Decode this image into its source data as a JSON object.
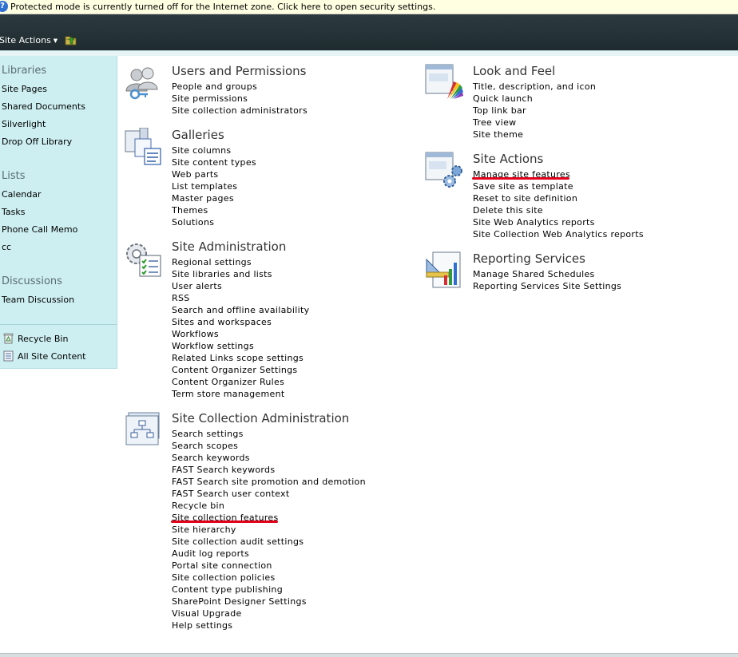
{
  "infobar": {
    "text": "Protected mode is currently turned off for the Internet zone.  Click here to open security settings.",
    "icon": "shield-info-icon"
  },
  "topbar": {
    "site_actions_label": "Site Actions",
    "nav_icon": "navigate-up-icon"
  },
  "quicklaunch": {
    "libraries_heading": "Libraries",
    "libraries": [
      "Site Pages",
      "Shared Documents",
      "Silverlight",
      "Drop Off Library"
    ],
    "lists_heading": "Lists",
    "lists": [
      "Calendar",
      "Tasks",
      "Phone Call Memo",
      "cc"
    ],
    "discussions_heading": "Discussions",
    "discussions": [
      "Team Discussion"
    ],
    "recycle_bin": "Recycle Bin",
    "all_site_content": "All Site Content"
  },
  "sections": {
    "users": {
      "title": "Users and Permissions",
      "links": [
        "People and groups",
        "Site permissions",
        "Site collection administrators"
      ]
    },
    "galleries": {
      "title": "Galleries",
      "links": [
        "Site columns",
        "Site content types",
        "Web parts",
        "List templates",
        "Master pages",
        "Themes",
        "Solutions"
      ]
    },
    "site_admin": {
      "title": "Site Administration",
      "links": [
        "Regional settings",
        "Site libraries and lists",
        "User alerts",
        "RSS",
        "Search and offline availability",
        "Sites and workspaces",
        "Workflows",
        "Workflow settings",
        "Related Links scope settings",
        "Content Organizer Settings",
        "Content Organizer Rules",
        "Term store management"
      ]
    },
    "site_collection_admin": {
      "title": "Site Collection Administration",
      "links": [
        "Search settings",
        "Search scopes",
        "Search keywords",
        "FAST Search keywords",
        "FAST Search site promotion and demotion",
        "FAST Search user context",
        "Recycle bin",
        "Site collection features",
        "Site hierarchy",
        "Site collection audit settings",
        "Audit log reports",
        "Portal site connection",
        "Site collection policies",
        "Content type publishing",
        "SharePoint Designer Settings",
        "Visual Upgrade",
        "Help settings"
      ]
    },
    "look_feel": {
      "title": "Look and Feel",
      "links": [
        "Title, description, and icon",
        "Quick launch",
        "Top link bar",
        "Tree view",
        "Site theme"
      ]
    },
    "site_actions": {
      "title": "Site Actions",
      "links": [
        "Manage site features",
        "Save site as template",
        "Reset to site definition",
        "Delete this site",
        "Site Web Analytics reports",
        "Site Collection Web Analytics reports"
      ]
    },
    "reporting": {
      "title": "Reporting Services",
      "links": [
        "Manage Shared Schedules",
        "Reporting Services Site Settings"
      ]
    }
  },
  "colors": {
    "highlight_underline": "#e2001a",
    "quicklaunch_bg": "#cdeff1",
    "topbar_bg": "#2c3a3f"
  }
}
